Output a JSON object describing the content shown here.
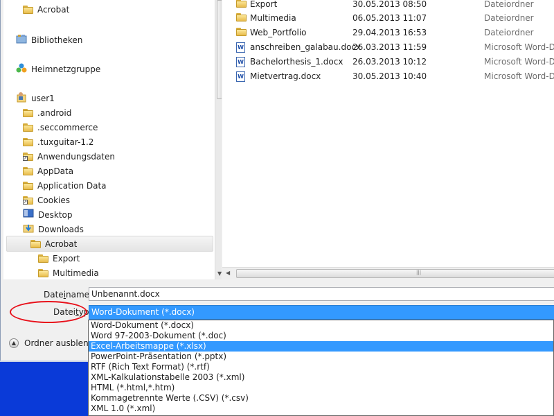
{
  "nav": {
    "items": [
      {
        "label": "Acrobat"
      },
      {
        "label": "Bibliotheken"
      },
      {
        "label": "Heimnetzgruppe"
      },
      {
        "label": "user1"
      },
      {
        "label": ".android"
      },
      {
        "label": ".seccommerce"
      },
      {
        "label": ".tuxguitar-1.2"
      },
      {
        "label": "Anwendungsdaten"
      },
      {
        "label": "AppData"
      },
      {
        "label": "Application Data"
      },
      {
        "label": "Cookies"
      },
      {
        "label": "Desktop"
      },
      {
        "label": "Downloads"
      },
      {
        "label": "Acrobat"
      },
      {
        "label": "Export"
      },
      {
        "label": "Multimedia"
      }
    ]
  },
  "files": {
    "rows": [
      {
        "name": "Export",
        "date": "30.05.2013 08:50",
        "type": "Dateiordner"
      },
      {
        "name": "Multimedia",
        "date": "06.05.2013 11:07",
        "type": "Dateiordner"
      },
      {
        "name": "Web_Portfolio",
        "date": "29.04.2013 16:53",
        "type": "Dateiordner"
      },
      {
        "name": "anschreiben_galabau.docx",
        "date": "26.03.2013 11:59",
        "type": "Microsoft Word-D..."
      },
      {
        "name": "Bachelorthesis_1.docx",
        "date": "26.03.2013 10:12",
        "type": "Microsoft Word-D..."
      },
      {
        "name": "Mietvertrag.docx",
        "date": "30.05.2013 10:40",
        "type": "Microsoft Word-D..."
      }
    ]
  },
  "form": {
    "filename_label_pre": "Date",
    "filename_label_u": "i",
    "filename_label_post": "name:",
    "filename_value": "Unbenannt.docx",
    "filetype_label_pre": "Datei",
    "filetype_label_u": "t",
    "filetype_label_post": "yp:",
    "filetype_selected": "Word-Dokument (*.docx)"
  },
  "filetype_options": [
    "Word-Dokument (*.docx)",
    "Word 97-2003-Dokument (*.doc)",
    "Excel-Arbeitsmappe (*.xlsx)",
    "PowerPoint-Präsentation (*.pptx)",
    "RTF (Rich Text Format) (*.rtf)",
    "XML-Kalkulationstabelle 2003 (*.xml)",
    "HTML (*.html,*.htm)",
    "Kommagetrennte Werte (.CSV) (*.csv)",
    "XML 1.0 (*.xml)"
  ],
  "highlighted_option_index": 2,
  "hide_folders_label": "Ordner ausblende",
  "colors": {
    "selection": "#3399ff",
    "annotation": "#e8101a",
    "desktop": "#0a3ad8"
  }
}
